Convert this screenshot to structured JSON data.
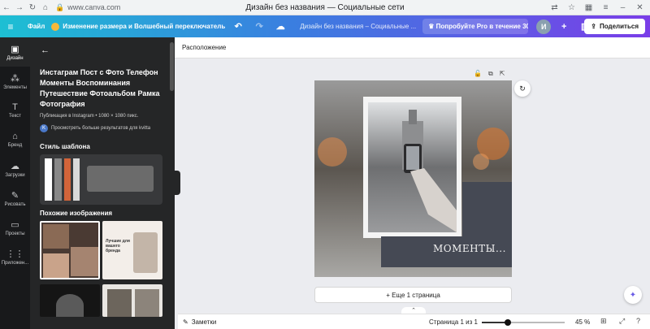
{
  "browser": {
    "url": "www.canva.com",
    "window_title": "Дизайн без названия — Социальные сети"
  },
  "topbar": {
    "file_label": "Файл",
    "resize_label": "Изменение размера и Волшебный переключатель",
    "doc_title": "Дизайн без названия – Социальные ...",
    "pro_label": "Попробуйте Pro в течение 30 ...",
    "avatar_initial": "И",
    "share_label": "Поделиться"
  },
  "rail": [
    {
      "label": "Дизайн",
      "icon": "design-icon",
      "glyph": "▣"
    },
    {
      "label": "Элементы",
      "icon": "elements-icon",
      "glyph": "⁂"
    },
    {
      "label": "Текст",
      "icon": "text-icon",
      "glyph": "T"
    },
    {
      "label": "Бренд",
      "icon": "brand-icon",
      "glyph": "⌂"
    },
    {
      "label": "Загрузки",
      "icon": "upload-icon",
      "glyph": "☁"
    },
    {
      "label": "Рисовать",
      "icon": "draw-icon",
      "glyph": "✎"
    },
    {
      "label": "Проекты",
      "icon": "folder-icon",
      "glyph": "▭"
    },
    {
      "label": "Приложен...",
      "icon": "apps-icon",
      "glyph": "⋮⋮"
    }
  ],
  "panel": {
    "title": "Инстаграм Пост с Фото Телефон Моменты Воспоминания Путешествие Фотоальбом Рамка Фотография",
    "subtitle": "Публикация в Instagram • 1080 × 1080 пикс.",
    "author_initial": "K",
    "author_link": "Просмотреть больше результатов для kvitta",
    "style_heading": "Стиль шаблона",
    "palette": [
      "#ffffff",
      "#888888",
      "#d2643a",
      "#d9d9d9",
      "#6b6b6b"
    ],
    "similar_heading": "Похожие изображения",
    "thumb2_text": "Лучшие для вашего бренда"
  },
  "workspace": {
    "subheader": "Расположение",
    "canvas_text": "МОМЕНТЫ...",
    "add_page": "+ Еще 1 страница"
  },
  "bottom": {
    "notes": "Заметки",
    "page_indicator": "Страница 1 из 1",
    "zoom_value": 45,
    "zoom_label": "45 %"
  }
}
